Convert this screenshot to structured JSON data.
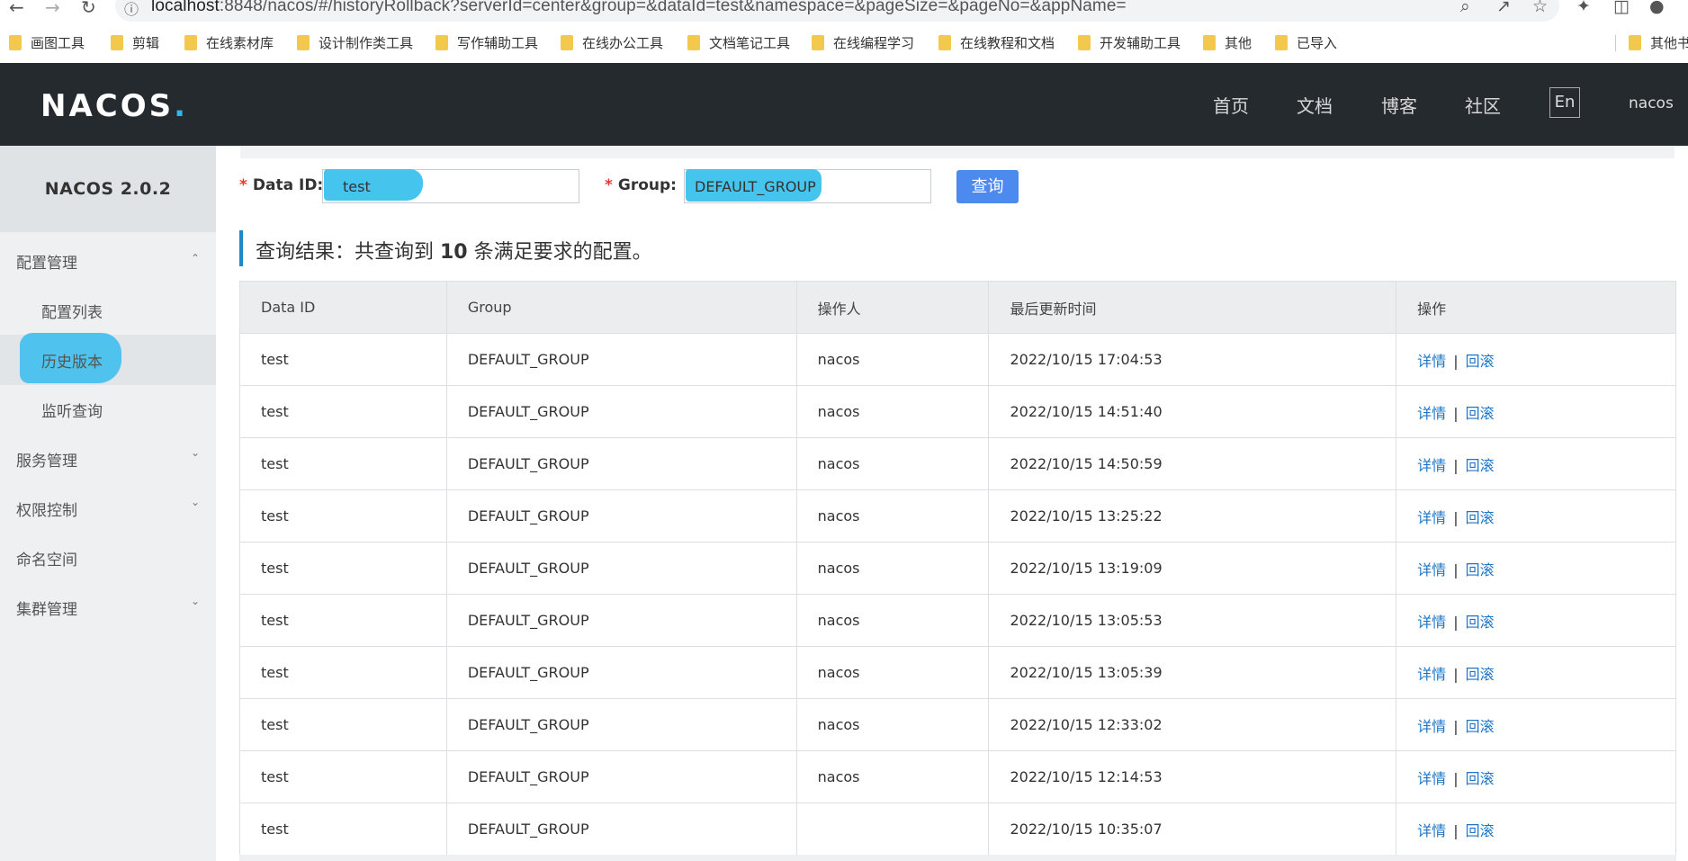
{
  "browser": {
    "url_host": "localhost",
    "url_rest": ":8848/nacos/#/historyRollback?serverId=center&group=&dataId=test&namespace=&pageSize=&pageNo=&appName=",
    "bookmarks": [
      "画图工具",
      "剪辑",
      "在线素材库",
      "设计制作类工具",
      "写作辅助工具",
      "在线办公工具",
      "文档笔记工具",
      "在线编程学习",
      "在线教程和文档",
      "开发辅助工具",
      "其他",
      "已导入"
    ],
    "other_bookmarks": "其他书"
  },
  "header": {
    "logo": "NACOS",
    "logo_dot": ".",
    "links": [
      "首页",
      "文档",
      "博客",
      "社区"
    ],
    "lang": "En",
    "user": "nacos"
  },
  "sidebar": {
    "title": "NACOS 2.0.2",
    "config_mgmt": "配置管理",
    "config_list": "配置列表",
    "history": "历史版本",
    "listener": "监听查询",
    "service_mgmt": "服务管理",
    "auth": "权限控制",
    "namespace": "命名空间",
    "cluster": "集群管理"
  },
  "search": {
    "dataid_label": "Data ID:",
    "dataid_value": "test",
    "group_label": "Group:",
    "group_value": "DEFAULT_GROUP",
    "required_mark": "*",
    "query_button": "查询"
  },
  "result": {
    "prefix": "查询结果：共查询到 ",
    "count": "10",
    "suffix": " 条满足要求的配置。"
  },
  "table": {
    "columns": [
      "Data ID",
      "Group",
      "操作人",
      "最后更新时间",
      "操作"
    ],
    "detail_label": "详情",
    "separator": "|",
    "rollback_label": "回滚",
    "rows": [
      {
        "data_id": "test",
        "group": "DEFAULT_GROUP",
        "operator": "nacos",
        "updated": "2022/10/15 17:04:53"
      },
      {
        "data_id": "test",
        "group": "DEFAULT_GROUP",
        "operator": "nacos",
        "updated": "2022/10/15 14:51:40"
      },
      {
        "data_id": "test",
        "group": "DEFAULT_GROUP",
        "operator": "nacos",
        "updated": "2022/10/15 14:50:59"
      },
      {
        "data_id": "test",
        "group": "DEFAULT_GROUP",
        "operator": "nacos",
        "updated": "2022/10/15 13:25:22"
      },
      {
        "data_id": "test",
        "group": "DEFAULT_GROUP",
        "operator": "nacos",
        "updated": "2022/10/15 13:19:09"
      },
      {
        "data_id": "test",
        "group": "DEFAULT_GROUP",
        "operator": "nacos",
        "updated": "2022/10/15 13:05:53"
      },
      {
        "data_id": "test",
        "group": "DEFAULT_GROUP",
        "operator": "nacos",
        "updated": "2022/10/15 13:05:39"
      },
      {
        "data_id": "test",
        "group": "DEFAULT_GROUP",
        "operator": "nacos",
        "updated": "2022/10/15 12:33:02"
      },
      {
        "data_id": "test",
        "group": "DEFAULT_GROUP",
        "operator": "nacos",
        "updated": "2022/10/15 12:14:53"
      },
      {
        "data_id": "test",
        "group": "DEFAULT_GROUP",
        "operator": "",
        "updated": "2022/10/15 10:35:07"
      }
    ]
  },
  "colors": {
    "header_bg": "#252a2f",
    "accent_blue": "#4d8af0",
    "link_blue": "#1c75c8",
    "highlight": "#45c5ee"
  }
}
